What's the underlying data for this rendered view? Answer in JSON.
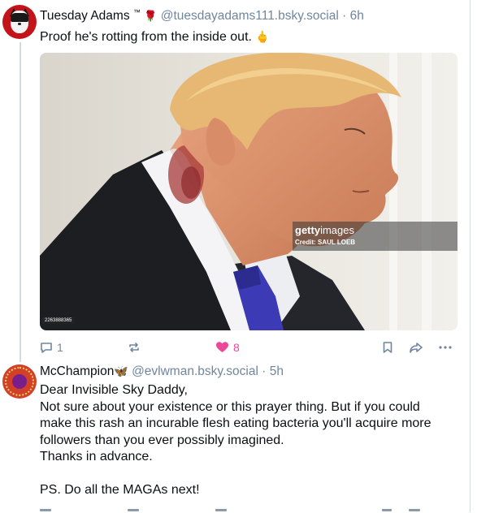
{
  "post1": {
    "display_name": "Tuesday Adams",
    "name_suffix": "™",
    "name_emoji": "🌹",
    "handle": "@tuesdayadams111.bsky.social",
    "separator": "·",
    "time": "6h",
    "text": "Proof he's rotting from the inside out.",
    "text_emoji": "🖕",
    "image": {
      "watermark_logo_a": "getty",
      "watermark_logo_b": "images",
      "watermark_credit": "Credit: SAUL LOEB",
      "image_id": "2263888365"
    },
    "reply_count": "1",
    "repost_count": "",
    "like_count": "8",
    "like_color": "#ec4899",
    "icons": [
      "reply-icon",
      "repost-icon",
      "heart-icon",
      "bookmark-icon",
      "share-icon",
      "more-icon"
    ]
  },
  "post2": {
    "display_name": "McChampion",
    "name_emoji": "🦋",
    "handle": "@evlwman.bsky.social",
    "separator": "·",
    "time": "5h",
    "lines": [
      "Dear Invisible Sky Daddy,",
      "Not sure about your existence or this prayer thing. But if you could",
      "make this rash an incurable flesh eating bacteria you'll acquire more",
      "followers than you ever possibly imagined.",
      "Thanks in advance.",
      "",
      "PS. Do all the MAGAs next!"
    ]
  },
  "colors": {
    "handle_gray": "#6f869f",
    "thread_line": "#d4dbe2",
    "text": "#0b0f14"
  }
}
